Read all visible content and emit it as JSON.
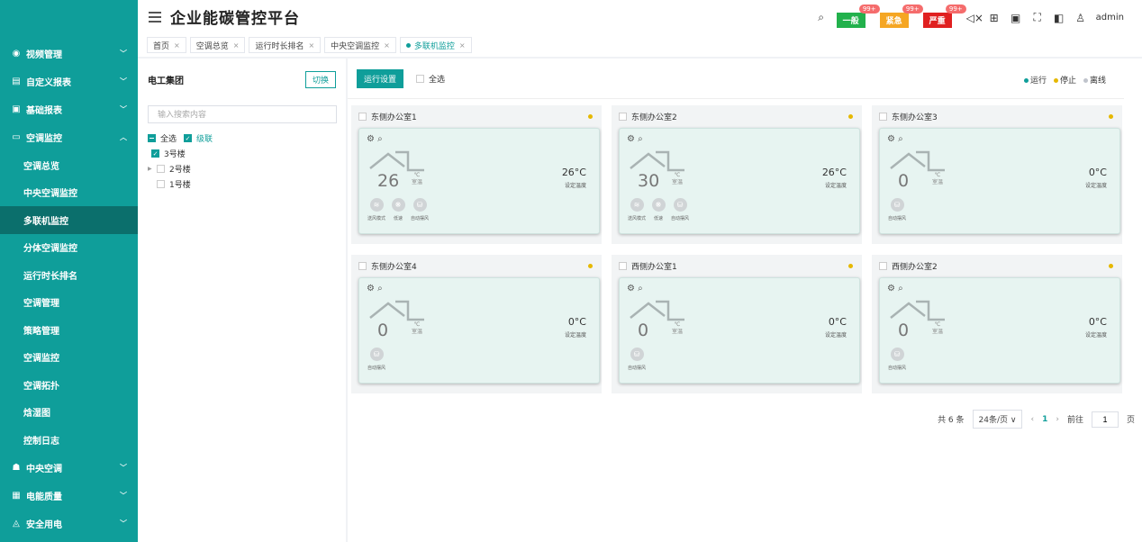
{
  "app": {
    "title": "企业能碳管控平台",
    "admin": "admin"
  },
  "header": {
    "alarms": [
      {
        "label": "一般",
        "count": "99+",
        "color": "#22b14c"
      },
      {
        "label": "紧急",
        "count": "99+",
        "color": "#f5a623"
      },
      {
        "label": "严重",
        "count": "99+",
        "color": "#e02020"
      }
    ]
  },
  "sidebar": {
    "menus": [
      {
        "label": "视频管理",
        "icon": "video-icon"
      },
      {
        "label": "自定义报表",
        "icon": "report-icon"
      },
      {
        "label": "基础报表",
        "icon": "basic-report-icon"
      },
      {
        "label": "空调监控",
        "icon": "ac-icon"
      }
    ],
    "sub_items": [
      "空调总览",
      "中央空调监控",
      "多联机监控",
      "分体空调监控",
      "运行时长排名",
      "空调管理",
      "策略管理",
      "空调监控",
      "空调拓扑",
      "焓湿图",
      "控制日志"
    ],
    "bottom_menus": [
      {
        "label": "中央空调",
        "icon": "central-ac-icon"
      },
      {
        "label": "电能质量",
        "icon": "power-quality-icon"
      },
      {
        "label": "安全用电",
        "icon": "safety-icon"
      }
    ]
  },
  "tabs": [
    {
      "label": "首页"
    },
    {
      "label": "空调总览"
    },
    {
      "label": "运行时长排名"
    },
    {
      "label": "中央空调监控"
    },
    {
      "label": "多联机监控"
    }
  ],
  "left_panel": {
    "title": "电工集团",
    "switch_label": "切换",
    "search_placeholder": "输入搜索内容",
    "select_all": "全选",
    "cascade": "级联",
    "tree": [
      "3号楼",
      "2号楼",
      "1号楼"
    ]
  },
  "toolbar": {
    "run_settings": "运行设置",
    "select_all": "全选",
    "legend": [
      {
        "label": "运行",
        "color": "#0f9e9a"
      },
      {
        "label": "停止",
        "color": "#e6b800"
      },
      {
        "label": "离线",
        "color": "#c0c4cc"
      }
    ]
  },
  "devices": [
    {
      "name": "东侧办公室1",
      "room_temp": "26",
      "unit": "℃",
      "room_label": "室温",
      "set_temp": "26°C",
      "set_label": "设定温度",
      "modes": [
        "送风模式",
        "低速",
        "自动摆风"
      ]
    },
    {
      "name": "东侧办公室2",
      "room_temp": "30",
      "unit": "℃",
      "room_label": "室温",
      "set_temp": "26°C",
      "set_label": "设定温度",
      "modes": [
        "送风模式",
        "低速",
        "自动摆风"
      ]
    },
    {
      "name": "东侧办公室3",
      "room_temp": "0",
      "unit": "℃",
      "room_label": "室温",
      "set_temp": "0°C",
      "set_label": "设定温度",
      "modes": [
        "自动摆风"
      ]
    },
    {
      "name": "东侧办公室4",
      "room_temp": "0",
      "unit": "℃",
      "room_label": "室温",
      "set_temp": "0°C",
      "set_label": "设定温度",
      "modes": [
        "自动摆风"
      ]
    },
    {
      "name": "西侧办公室1",
      "room_temp": "0",
      "unit": "℃",
      "room_label": "室温",
      "set_temp": "0°C",
      "set_label": "设定温度",
      "modes": [
        "自动摆风"
      ]
    },
    {
      "name": "西侧办公室2",
      "room_temp": "0",
      "unit": "℃",
      "room_label": "室温",
      "set_temp": "0°C",
      "set_label": "设定温度",
      "modes": [
        "自动摆风"
      ]
    }
  ],
  "pagination": {
    "total": "共 6 条",
    "page_size": "24条/页",
    "current": "1",
    "goto_label": "前往",
    "goto_value": "1",
    "page_suffix": "页"
  }
}
